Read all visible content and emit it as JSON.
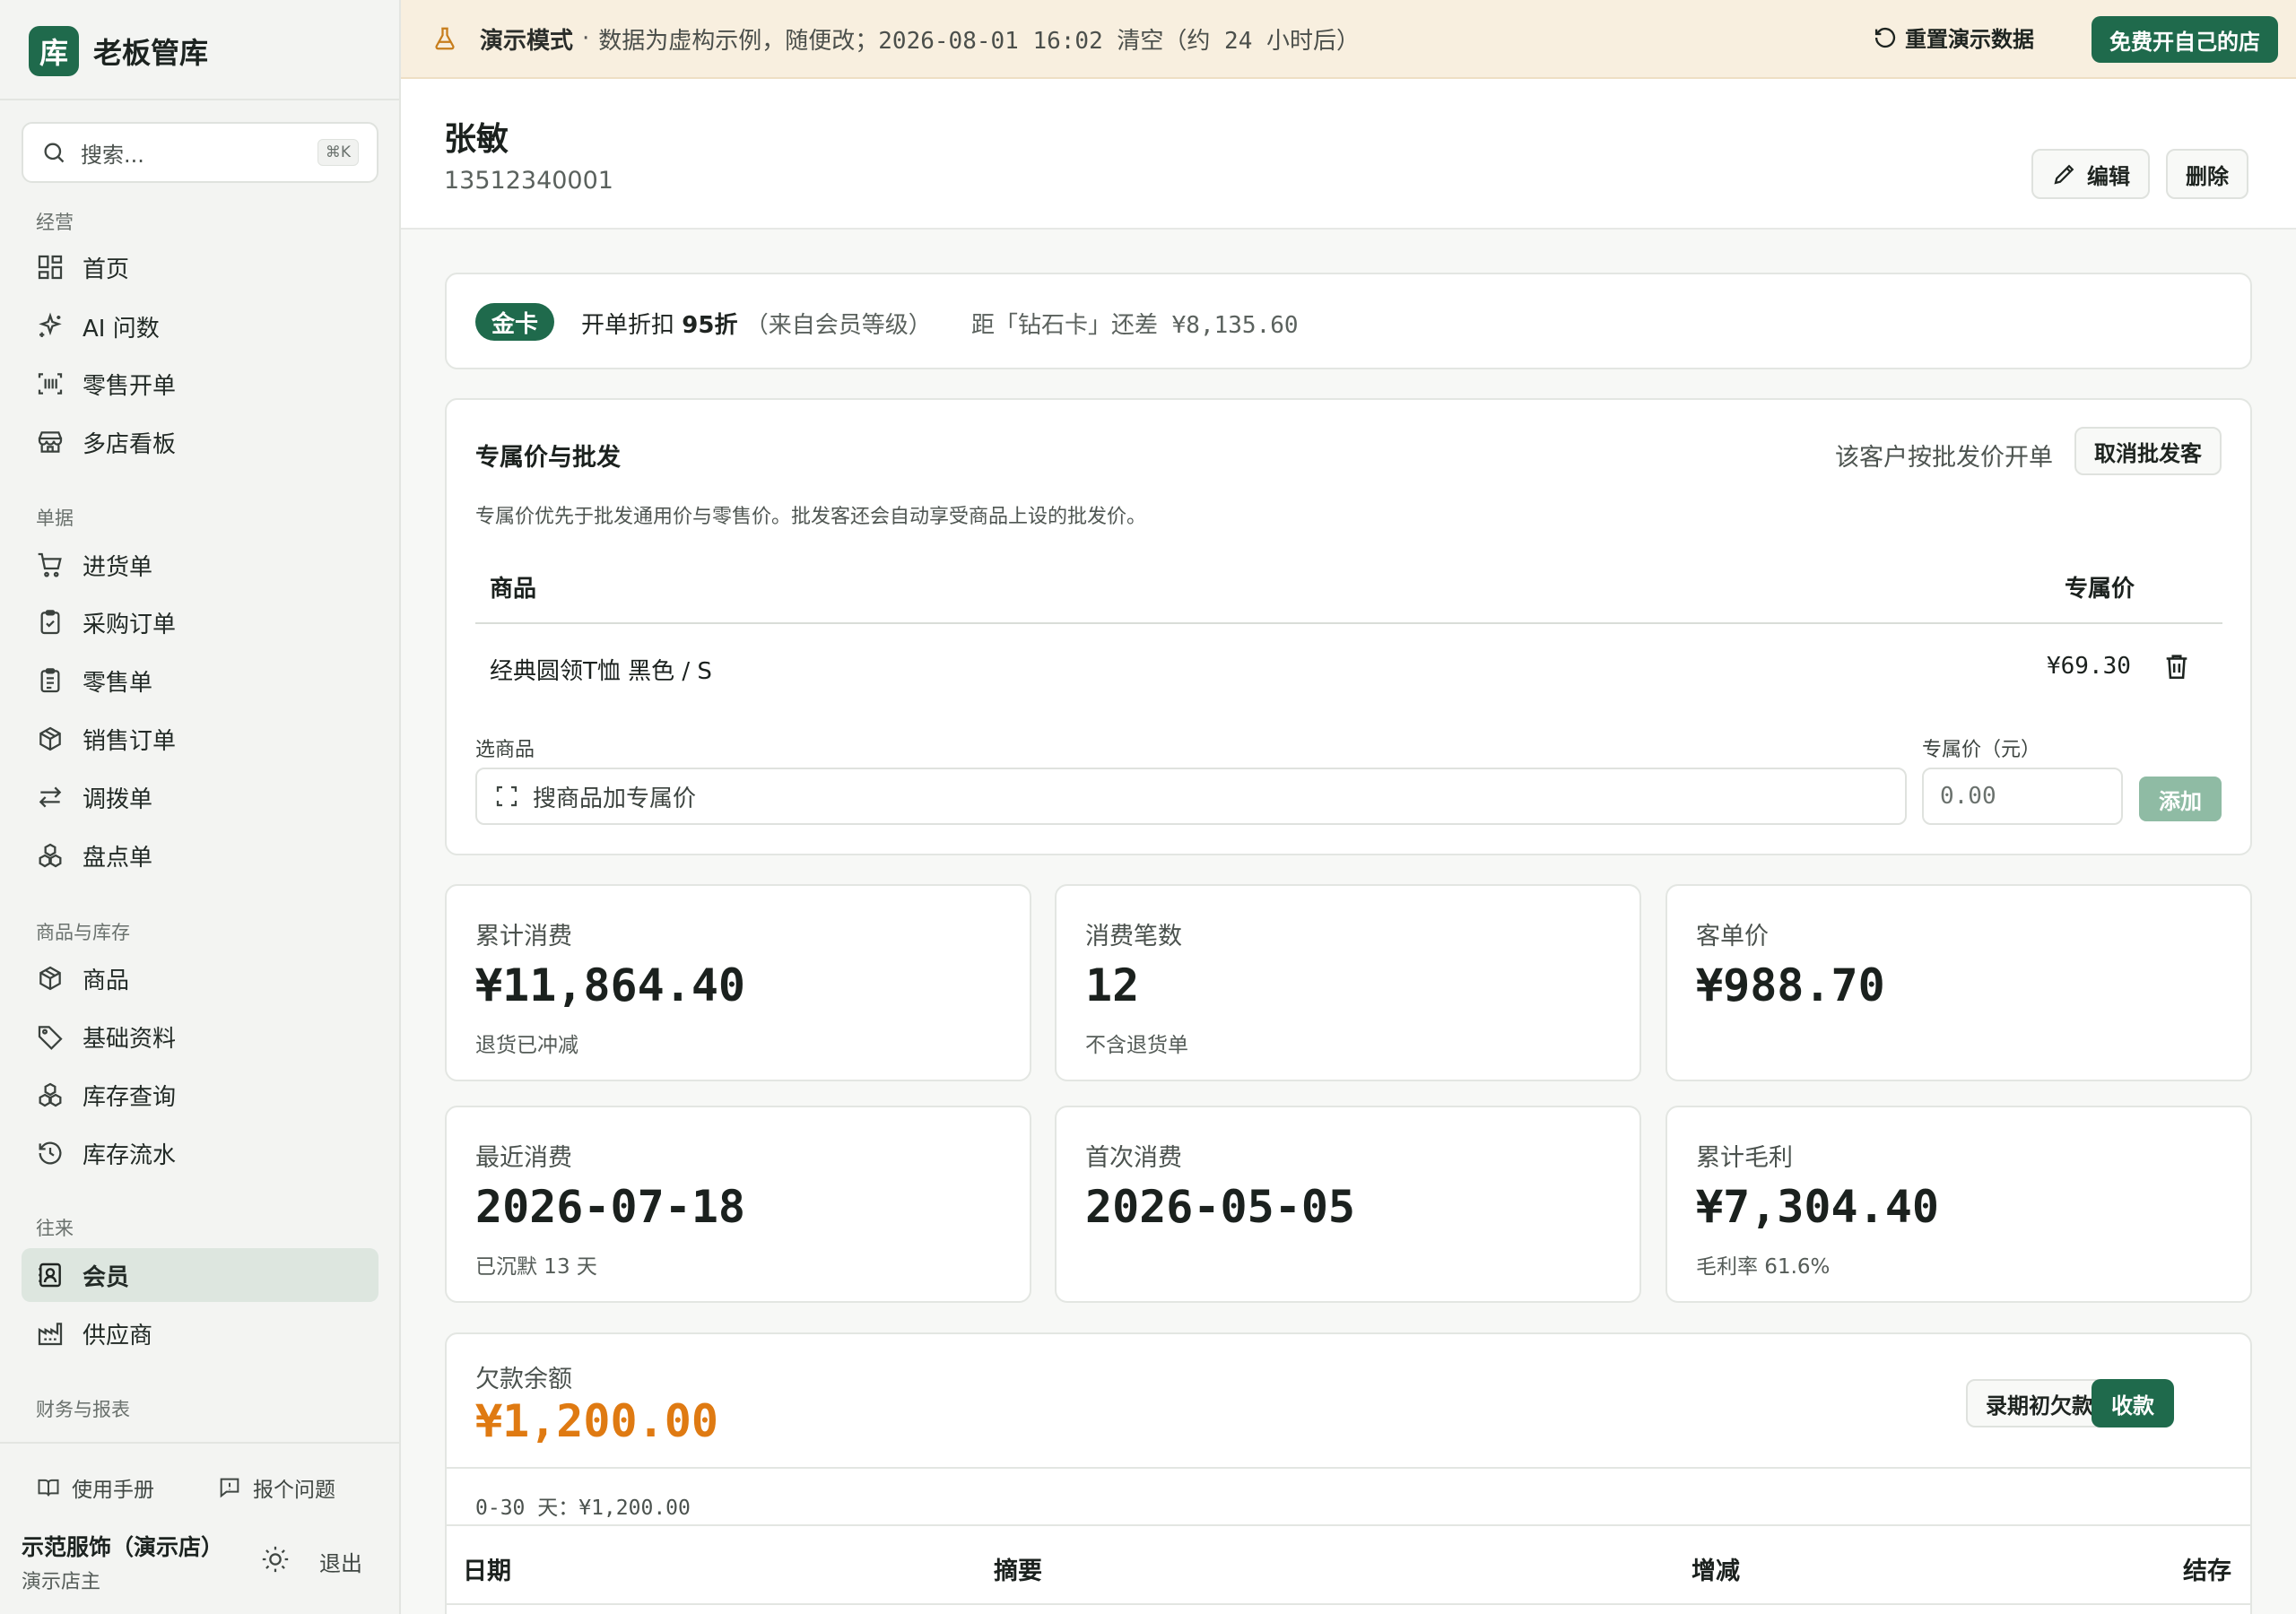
{
  "app": {
    "logo_char": "库",
    "name": "老板管库"
  },
  "search": {
    "placeholder": "搜索...",
    "shortcut": "⌘K"
  },
  "nav": {
    "sections": [
      "经营",
      "单据",
      "商品与库存",
      "往来",
      "财务与报表"
    ],
    "items": [
      {
        "label": "首页",
        "icon": "dashboard-icon"
      },
      {
        "label": "AI 问数",
        "icon": "sparkles-icon"
      },
      {
        "label": "零售开单",
        "icon": "barcode-scan-icon"
      },
      {
        "label": "多店看板",
        "icon": "store-icon"
      },
      {
        "label": "进货单",
        "icon": "cart-icon"
      },
      {
        "label": "采购订单",
        "icon": "clipboard-check-icon"
      },
      {
        "label": "零售单",
        "icon": "clipboard-list-icon"
      },
      {
        "label": "销售订单",
        "icon": "package-icon"
      },
      {
        "label": "调拨单",
        "icon": "transfer-icon"
      },
      {
        "label": "盘点单",
        "icon": "boxes-icon"
      },
      {
        "label": "商品",
        "icon": "package-icon"
      },
      {
        "label": "基础资料",
        "icon": "tag-icon"
      },
      {
        "label": "库存查询",
        "icon": "boxes-icon"
      },
      {
        "label": "库存流水",
        "icon": "history-icon"
      },
      {
        "label": "会员",
        "icon": "contact-icon",
        "active": true
      },
      {
        "label": "供应商",
        "icon": "factory-icon"
      }
    ]
  },
  "footer": {
    "manual": "使用手册",
    "report": "报个问题",
    "store_name": "示范服饰（演示店）",
    "store_role": "演示店主",
    "logout": "退出"
  },
  "banner": {
    "mode": "演示模式",
    "separator": "·",
    "text": "数据为虚构示例，随便改；2026-08-01 16:02 清空（约 24 小时后）",
    "reset": "重置演示数据",
    "cta": "免费开自己的店"
  },
  "customer": {
    "name": "张敏",
    "phone": "13512340001",
    "edit": "编辑",
    "delete": "删除"
  },
  "tier": {
    "badge": "金卡",
    "discount_prefix": "开单折扣 ",
    "discount": "95折",
    "discount_note": "（来自会员等级）",
    "gap": "距「钻石卡」还差 ¥8,135.60"
  },
  "pricing": {
    "title": "专属价与批发",
    "wholesale_text": "该客户按批发价开单",
    "cancel_wholesale": "取消批发客",
    "desc": "专属价优先于批发通用价与零售价。批发客还会自动享受商品上设的批发价。",
    "col_product": "商品",
    "col_price": "专属价",
    "rows": [
      {
        "product": "经典圆领T恤 黑色 / S",
        "price": "¥69.30"
      }
    ],
    "select_label": "选商品",
    "price_label": "专属价（元）",
    "product_placeholder": "搜商品加专属价",
    "price_placeholder": "0.00",
    "add": "添加"
  },
  "stats": [
    {
      "label": "累计消费",
      "value": "¥11,864.40",
      "sub": "退货已冲减"
    },
    {
      "label": "消费笔数",
      "value": "12",
      "sub": "不含退货单"
    },
    {
      "label": "客单价",
      "value": "¥988.70",
      "sub": ""
    },
    {
      "label": "最近消费",
      "value": "2026-07-18",
      "sub": "已沉默 13 天"
    },
    {
      "label": "首次消费",
      "value": "2026-05-05",
      "sub": ""
    },
    {
      "label": "累计毛利",
      "value": "¥7,304.40",
      "sub": "毛利率 61.6%"
    }
  ],
  "debt": {
    "label": "欠款余额",
    "value": "¥1,200.00",
    "opening": "录期初欠款",
    "collect": "收款",
    "aging": "0-30 天：¥1,200.00",
    "cols": [
      "日期",
      "摘要",
      "增减",
      "结存"
    ]
  }
}
